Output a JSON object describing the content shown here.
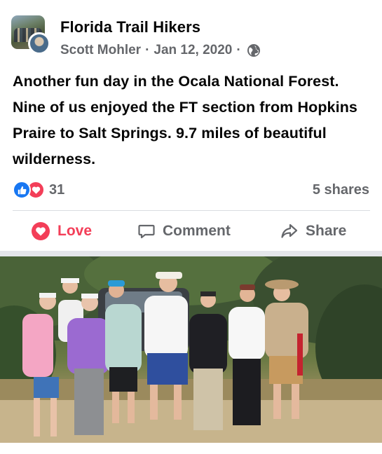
{
  "post": {
    "group_name": "Florida Trail Hikers",
    "author": "Scott Mohler",
    "separator": "·",
    "date": "Jan 12, 2020",
    "visibility_icon": "globe-icon",
    "text": "Another fun day in the Ocala National Forest. Nine of us enjoyed the FT section from Hopkins Praire to Salt Springs. 9.7 miles of beautiful wilderness."
  },
  "stats": {
    "reaction_icons": [
      "like-reaction-icon",
      "love-reaction-icon"
    ],
    "reaction_count": "31",
    "shares": "5 shares"
  },
  "actions": {
    "love_label": "Love",
    "comment_label": "Comment",
    "share_label": "Share"
  },
  "colors": {
    "love": "#f33e58",
    "like": "#1877f2",
    "secondary_text": "#65676b",
    "divider": "#dadde1"
  },
  "photo": {
    "subject": "group-hiking-photo"
  }
}
